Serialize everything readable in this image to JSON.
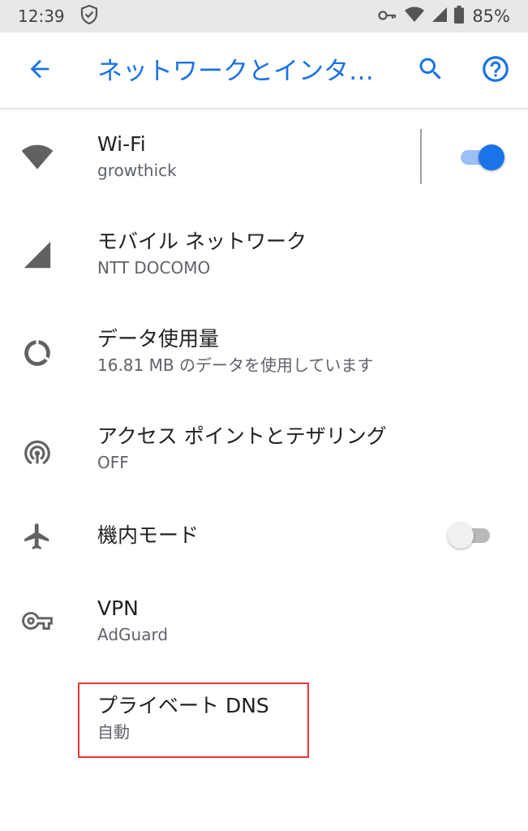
{
  "status_bar": {
    "time": "12:39",
    "battery_percent": "85%",
    "icons": [
      "shield-check-icon",
      "vpn-key-icon",
      "wifi-icon",
      "cell-signal-icon",
      "battery-icon"
    ]
  },
  "app_bar": {
    "title": "ネットワークとインターネット",
    "back_icon": "arrow-back-icon",
    "search_icon": "search-icon",
    "help_icon": "help-icon",
    "accent_color": "#1a73e8"
  },
  "items": [
    {
      "id": "wifi",
      "icon": "wifi-icon",
      "title": "Wi-Fi",
      "summary": "growthick",
      "toggle": true
    },
    {
      "id": "mobile",
      "icon": "cell-signal-icon",
      "title": "モバイル ネットワーク",
      "summary": "NTT DOCOMO"
    },
    {
      "id": "data",
      "icon": "data-usage-icon",
      "title": "データ使用量",
      "summary": "16.81 MB のデータを使用しています"
    },
    {
      "id": "hotspot",
      "icon": "hotspot-icon",
      "title": "アクセス ポイントとテザリング",
      "summary": "OFF"
    },
    {
      "id": "airplane",
      "icon": "airplane-icon",
      "title": "機内モード",
      "toggle": false
    },
    {
      "id": "vpn",
      "icon": "vpn-key-icon",
      "title": "VPN",
      "summary": "AdGuard"
    },
    {
      "id": "private_dns",
      "title": "プライベート DNS",
      "summary": "自動",
      "highlighted": true
    }
  ],
  "highlight_color": "#e53935"
}
